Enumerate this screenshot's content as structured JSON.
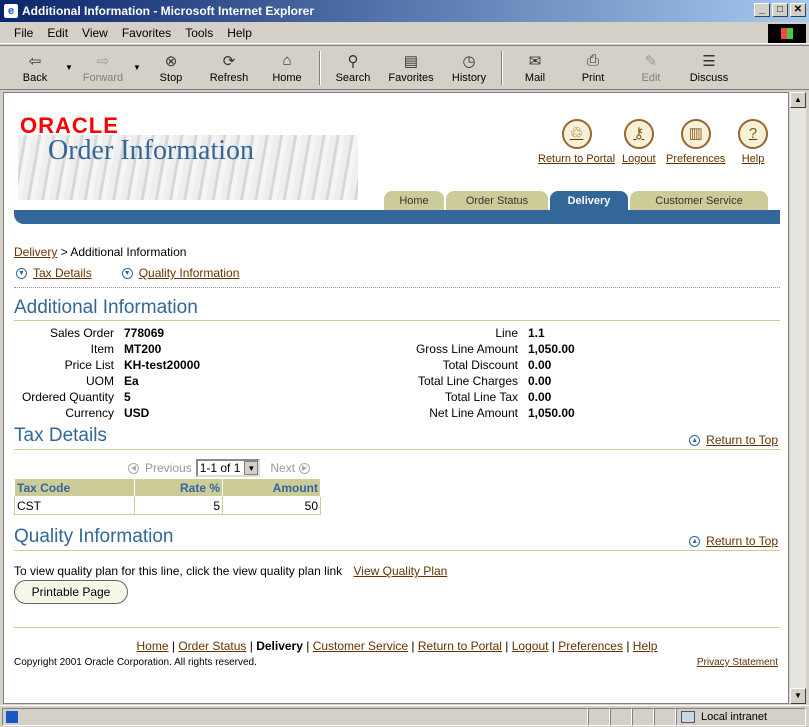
{
  "window": {
    "title": "Additional Information - Microsoft Internet Explorer",
    "min": "_",
    "max": "□",
    "close": "✕"
  },
  "menu": [
    "File",
    "Edit",
    "View",
    "Favorites",
    "Tools",
    "Help"
  ],
  "toolbar": {
    "back": "Back",
    "forward": "Forward",
    "stop": "Stop",
    "refresh": "Refresh",
    "home": "Home",
    "search": "Search",
    "favorites": "Favorites",
    "history": "History",
    "mail": "Mail",
    "print": "Print",
    "edit": "Edit",
    "discuss": "Discuss"
  },
  "brand": {
    "logo": "ORACLE",
    "app": "Order Information"
  },
  "global": {
    "portal": "Return to Portal",
    "logout": "Logout",
    "prefs": "Preferences",
    "help": "Help"
  },
  "tabs": {
    "home": "Home",
    "order_status": "Order Status",
    "delivery": "Delivery",
    "customer_service": "Customer Service"
  },
  "breadcrumb": {
    "link": "Delivery",
    "sep": ">",
    "current": "Additional Information"
  },
  "sublinks": {
    "tax": "Tax Details",
    "quality": "Quality Information"
  },
  "section": {
    "additional": "Additional Information",
    "tax": "Tax Details",
    "quality": "Quality Information",
    "return_top": "Return to Top"
  },
  "left_fields": [
    {
      "k": "Sales Order",
      "v": "778069"
    },
    {
      "k": "Item",
      "v": "MT200"
    },
    {
      "k": "Price List",
      "v": "KH-test20000"
    },
    {
      "k": "UOM",
      "v": "Ea"
    },
    {
      "k": "Ordered Quantity",
      "v": "5"
    },
    {
      "k": "Currency",
      "v": "USD"
    }
  ],
  "right_fields": [
    {
      "k": "Line",
      "v": "1.1"
    },
    {
      "k": "Gross Line Amount",
      "v": "1,050.00"
    },
    {
      "k": "Total Discount",
      "v": "0.00"
    },
    {
      "k": "Total Line Charges",
      "v": "0.00"
    },
    {
      "k": "Total Line Tax",
      "v": "0.00"
    },
    {
      "k": "Net Line Amount",
      "v": "1,050.00"
    }
  ],
  "pager": {
    "prev": "Previous",
    "range": "1-1 of 1",
    "next": "Next"
  },
  "tax_table": {
    "headers": [
      "Tax Code",
      "Rate %",
      "Amount"
    ],
    "row": [
      "CST",
      "5",
      "50"
    ]
  },
  "quality": {
    "text": "To view quality plan for this line, click the view quality plan link",
    "link": "View Quality Plan"
  },
  "printable": "Printable Page",
  "footer": {
    "home": "Home",
    "order_status": "Order Status",
    "delivery": "Delivery",
    "customer_service": "Customer Service",
    "portal": "Return to Portal",
    "logout": "Logout",
    "prefs": "Preferences",
    "help": "Help",
    "sep": "|",
    "copyright": "Copyright 2001 Oracle Corporation. All rights reserved.",
    "privacy": "Privacy Statement"
  },
  "status": {
    "zone": "Local intranet"
  }
}
